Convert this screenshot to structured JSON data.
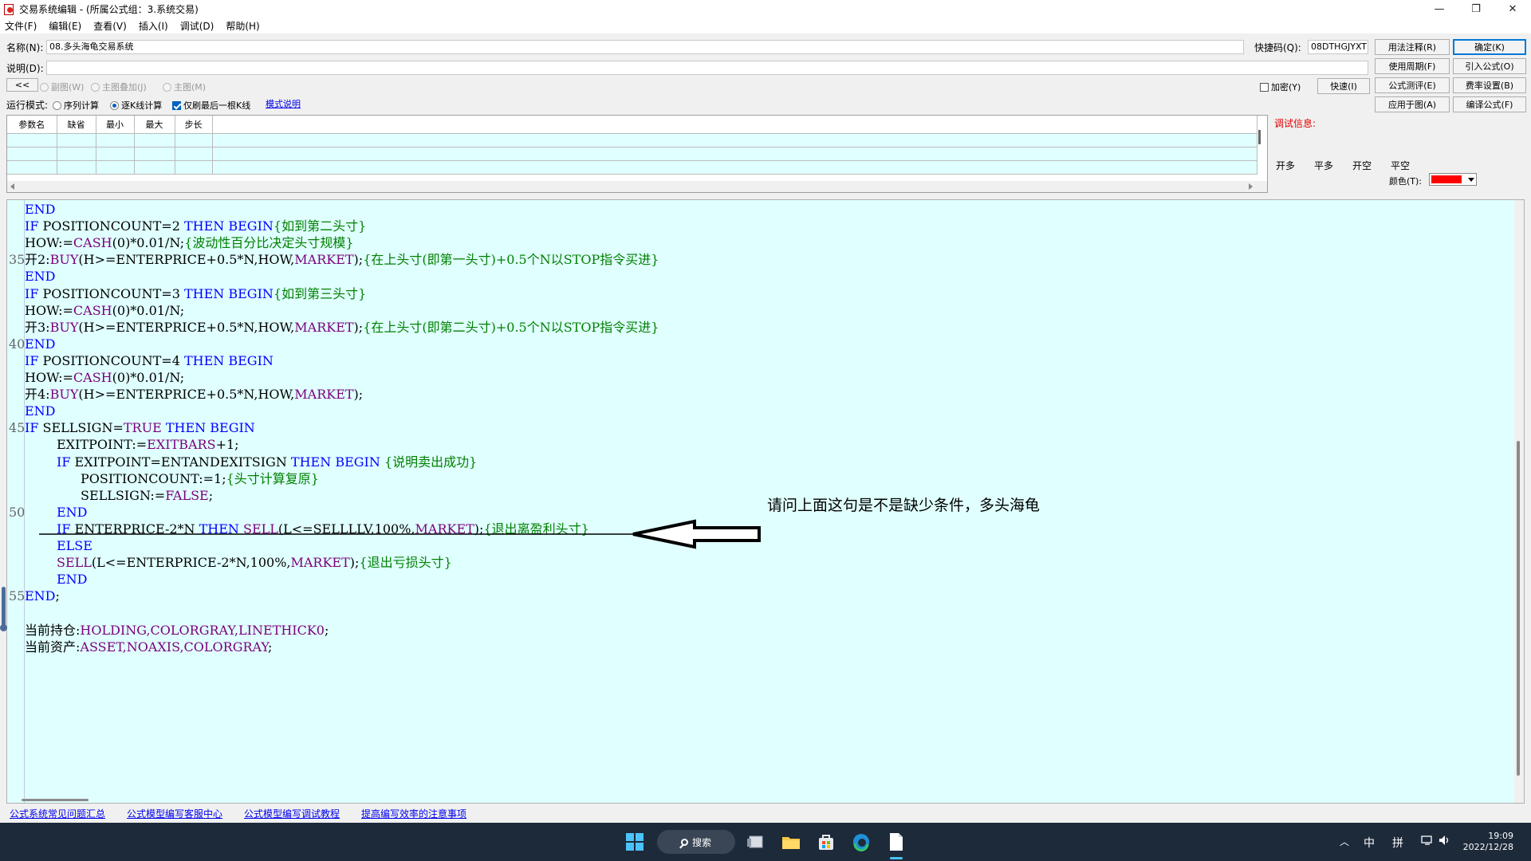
{
  "window": {
    "title": "交易系统编辑 - (所属公式组：3.系统交易)",
    "controls": [
      "—",
      "❐",
      "✕"
    ]
  },
  "menu": [
    "文件(F)",
    "编辑(E)",
    "查看(V)",
    "插入(I)",
    "调试(D)",
    "帮助(H)"
  ],
  "form": {
    "name_label": "名称(N):",
    "name_value": "08.多头海龟交易系统",
    "shortcut_label": "快捷码(Q):",
    "shortcut_value": "08DTHGJYXT",
    "desc_label": "说明(D):",
    "desc_value": "",
    "collapse_label": "<<",
    "chart_options": [
      "副图(W)",
      "主图叠加(J)",
      "主图(M)"
    ],
    "encrypt_label": "加密(Y)",
    "run_mode_label": "运行模式:",
    "run_modes": [
      "序列计算",
      "逐K线计算"
    ],
    "last_bar_label": "仅刷最后一根K线",
    "mode_help_link": "模式说明"
  },
  "buttons": {
    "fast": "快速(I)",
    "usage_notes": "用法注释(R)",
    "confirm": "确定(K)",
    "use_period": "使用周期(F)",
    "import_formula": "引入公式(O)",
    "formula_test": "公式测评(E)",
    "fee_setting": "费率设置(B)",
    "apply_chart": "应用于图(A)",
    "compile": "编译公式(F)"
  },
  "param_table": {
    "headers": [
      "参数名",
      "缺省",
      "最小",
      "最大",
      "步长"
    ]
  },
  "debug": {
    "label": "调试信息:",
    "signals": [
      "开多",
      "平多",
      "开空",
      "平空"
    ],
    "color_label": "颜色(T):",
    "color_value": "#ff0000"
  },
  "editor": {
    "line_numbers": [
      {
        "n": "35",
        "row": 3
      },
      {
        "n": "40",
        "row": 8
      },
      {
        "n": "45",
        "row": 13
      },
      {
        "n": "50",
        "row": 18
      },
      {
        "n": "55",
        "row": 23
      }
    ],
    "lines": [
      {
        "indent": 0,
        "tokens": [
          [
            "kw",
            "END"
          ]
        ]
      },
      {
        "indent": 0,
        "tokens": [
          [
            "kw",
            "IF"
          ],
          [
            "tx",
            " POSITIONCOUNT=2 "
          ],
          [
            "kw",
            "THEN BEGIN"
          ],
          [
            "cm",
            "{如到第二头寸}"
          ]
        ]
      },
      {
        "indent": 0,
        "tokens": [
          [
            "tx",
            "HOW:="
          ],
          [
            "fn",
            "CASH"
          ],
          [
            "tx",
            "(0)*0.01/N;"
          ],
          [
            "cm",
            "{波动性百分比决定头寸规模}"
          ]
        ]
      },
      {
        "indent": 0,
        "tokens": [
          [
            "tx",
            "开2:"
          ],
          [
            "fn",
            "BUY"
          ],
          [
            "tx",
            "(H>=ENTERPRICE+0.5*N,HOW,"
          ],
          [
            "fn",
            "MARKET"
          ],
          [
            "tx",
            ");"
          ],
          [
            "cm",
            "{在上头寸(即第一头寸)+0.5个N以STOP指令买进}"
          ]
        ]
      },
      {
        "indent": 0,
        "tokens": [
          [
            "kw",
            "END"
          ]
        ]
      },
      {
        "indent": 0,
        "tokens": [
          [
            "kw",
            "IF"
          ],
          [
            "tx",
            " POSITIONCOUNT=3 "
          ],
          [
            "kw",
            "THEN BEGIN"
          ],
          [
            "cm",
            "{如到第三头寸}"
          ]
        ]
      },
      {
        "indent": 0,
        "tokens": [
          [
            "tx",
            "HOW:="
          ],
          [
            "fn",
            "CASH"
          ],
          [
            "tx",
            "(0)*0.01/N;"
          ]
        ]
      },
      {
        "indent": 0,
        "tokens": [
          [
            "tx",
            "开3:"
          ],
          [
            "fn",
            "BUY"
          ],
          [
            "tx",
            "(H>=ENTERPRICE+0.5*N,HOW,"
          ],
          [
            "fn",
            "MARKET"
          ],
          [
            "tx",
            ");"
          ],
          [
            "cm",
            "{在上头寸(即第二头寸)+0.5个N以STOP指令买进}"
          ]
        ]
      },
      {
        "indent": 0,
        "tokens": [
          [
            "kw",
            "END"
          ]
        ]
      },
      {
        "indent": 0,
        "tokens": [
          [
            "kw",
            "IF"
          ],
          [
            "tx",
            " POSITIONCOUNT=4 "
          ],
          [
            "kw",
            "THEN BEGIN"
          ]
        ]
      },
      {
        "indent": 0,
        "tokens": [
          [
            "tx",
            "HOW:="
          ],
          [
            "fn",
            "CASH"
          ],
          [
            "tx",
            "(0)*0.01/N;"
          ]
        ]
      },
      {
        "indent": 0,
        "tokens": [
          [
            "tx",
            "开4:"
          ],
          [
            "fn",
            "BUY"
          ],
          [
            "tx",
            "(H>=ENTERPRICE+0.5*N,HOW,"
          ],
          [
            "fn",
            "MARKET"
          ],
          [
            "tx",
            ");"
          ]
        ]
      },
      {
        "indent": 0,
        "tokens": [
          [
            "kw",
            "END"
          ]
        ]
      },
      {
        "indent": 0,
        "tokens": [
          [
            "kw",
            "IF"
          ],
          [
            "tx",
            " SELLSIGN="
          ],
          [
            "fn",
            "TRUE"
          ],
          [
            "tx",
            " "
          ],
          [
            "kw",
            "THEN BEGIN"
          ]
        ]
      },
      {
        "indent": 1,
        "tokens": [
          [
            "tx",
            "EXITPOINT:="
          ],
          [
            "fn",
            "EXITBARS"
          ],
          [
            "tx",
            "+1;"
          ]
        ]
      },
      {
        "indent": 1,
        "tokens": [
          [
            "kw",
            "IF"
          ],
          [
            "tx",
            " EXITPOINT=ENTANDEXITSIGN "
          ],
          [
            "kw",
            "THEN BEGIN"
          ],
          [
            "tx",
            " "
          ],
          [
            "cm",
            "{说明卖出成功}"
          ]
        ]
      },
      {
        "indent": 2,
        "tokens": [
          [
            "tx",
            "POSITIONCOUNT:=1;"
          ],
          [
            "cm",
            "{头寸计算复原}"
          ]
        ]
      },
      {
        "indent": 2,
        "tokens": [
          [
            "tx",
            "SELLSIGN:="
          ],
          [
            "fn",
            "FALSE"
          ],
          [
            "tx",
            ";"
          ]
        ]
      },
      {
        "indent": 1,
        "tokens": [
          [
            "kw",
            "END"
          ]
        ]
      },
      {
        "indent": 1,
        "tokens": [
          [
            "kw",
            "IF"
          ],
          [
            "tx",
            " ENTERPRICE-2*N "
          ],
          [
            "kw",
            "THEN"
          ],
          [
            "tx",
            " "
          ],
          [
            "fn",
            "SELL"
          ],
          [
            "tx",
            "(L<=SELLLLV,100%,"
          ],
          [
            "fn",
            "MARKET"
          ],
          [
            "tx",
            ");"
          ],
          [
            "cm",
            "{退出离盈利头寸}"
          ]
        ]
      },
      {
        "indent": 1,
        "tokens": [
          [
            "kw",
            "ELSE"
          ]
        ]
      },
      {
        "indent": 1,
        "tokens": [
          [
            "fn",
            "SELL"
          ],
          [
            "tx",
            "(L<=ENTERPRICE-2*N,100%,"
          ],
          [
            "fn",
            "MARKET"
          ],
          [
            "tx",
            ");"
          ],
          [
            "cm",
            "{退出亏损头寸}"
          ]
        ]
      },
      {
        "indent": 1,
        "tokens": [
          [
            "kw",
            "END"
          ]
        ]
      },
      {
        "indent": 0,
        "tokens": [
          [
            "kw",
            "END"
          ],
          [
            "tx",
            ";"
          ]
        ]
      },
      {
        "indent": 0,
        "tokens": []
      },
      {
        "indent": 0,
        "tokens": [
          [
            "tx",
            "当前持仓:"
          ],
          [
            "fn",
            "HOLDING,COLORGRAY,LINETHICK0"
          ],
          [
            "tx",
            ";"
          ]
        ]
      },
      {
        "indent": 0,
        "tokens": [
          [
            "tx",
            "当前资产:"
          ],
          [
            "fn",
            "ASSET,NOAXIS,COLORGRAY"
          ],
          [
            "tx",
            ";"
          ]
        ]
      }
    ]
  },
  "annotation": {
    "text": "请问上面这句是不是缺少条件，多头海龟"
  },
  "bottom_links": [
    "公式系统常见问题汇总",
    "公式模型编写客服中心",
    "公式模型编写调试教程",
    "提高编写效率的注意事项"
  ],
  "taskbar": {
    "search_label": "搜索",
    "ime_lang": "中",
    "ime_mode": "拼",
    "time": "19:09",
    "date": "2022/12/28"
  }
}
